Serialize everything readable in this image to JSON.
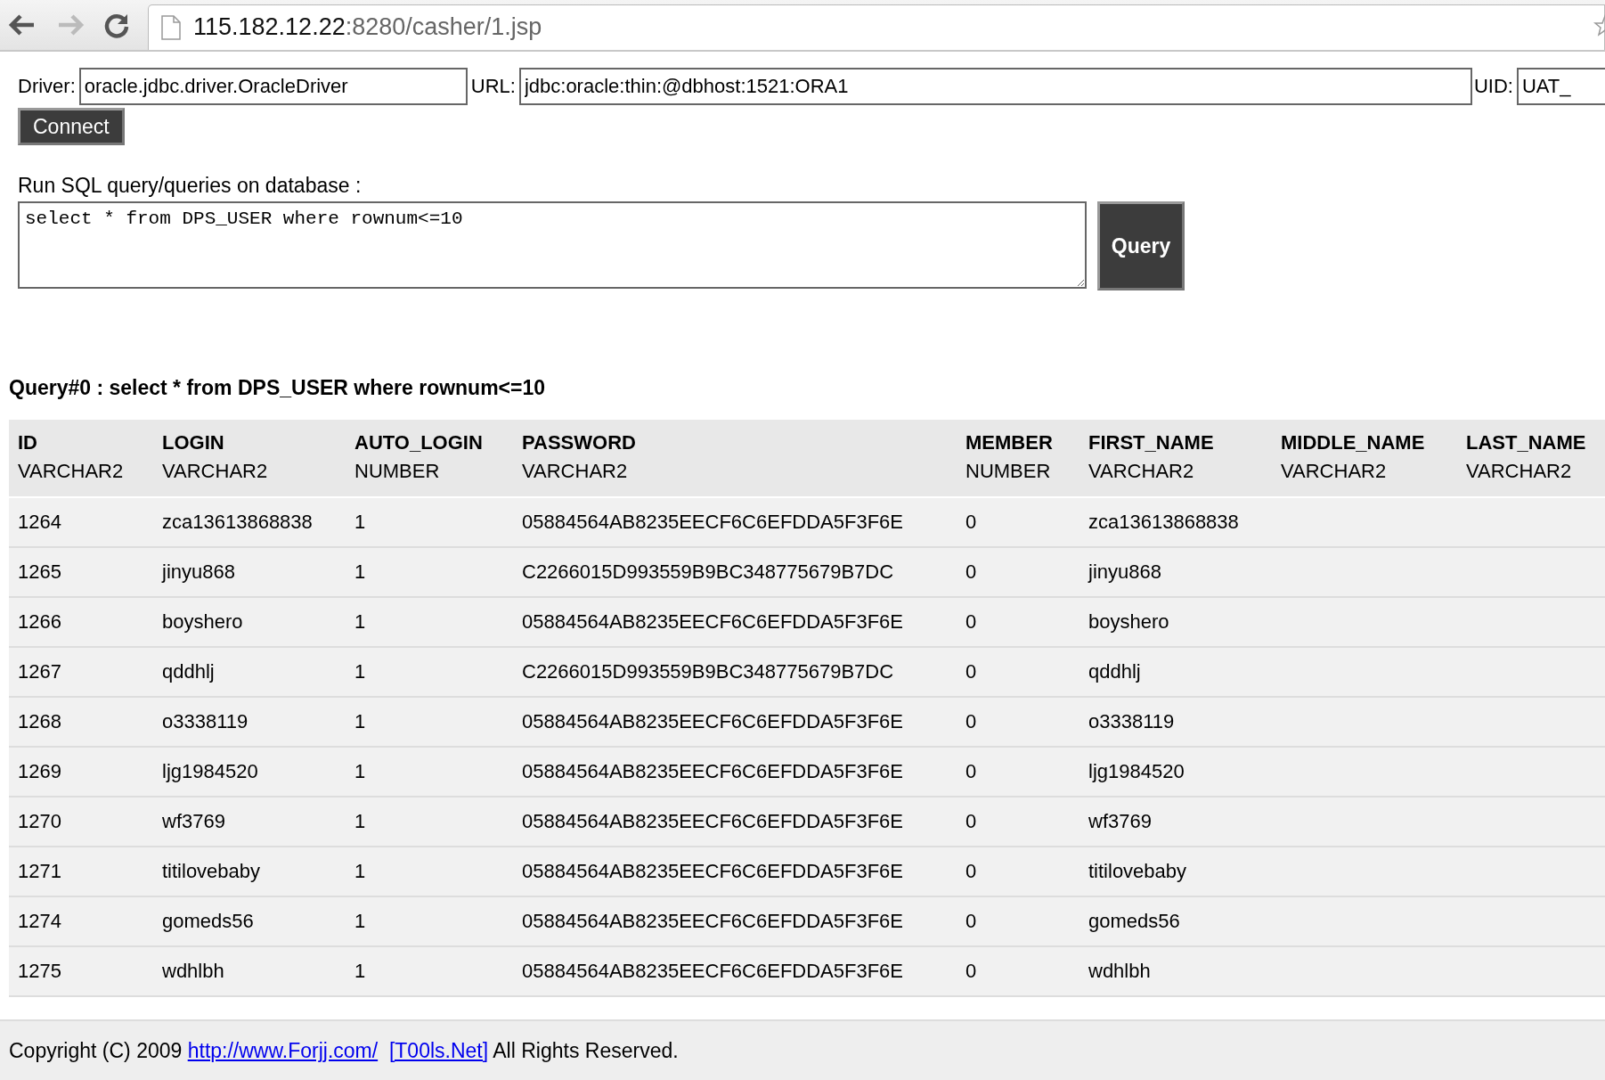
{
  "browser": {
    "address_host": "115.182.12.22",
    "address_path": ":8280/casher/1.jsp",
    "forward_disabled": true
  },
  "connection": {
    "driver_label": "Driver:",
    "driver_value": "oracle.jdbc.driver.OracleDriver",
    "url_label": "URL:",
    "url_value": "jdbc:oracle:thin:@dbhost:1521:ORA1",
    "uid_label": "UID:",
    "uid_value": "UAT_",
    "connect_button": "Connect"
  },
  "query_form": {
    "label": "Run SQL query/queries on database :",
    "sql": "select * from DPS_USER where rownum<=10",
    "query_button": "Query"
  },
  "result": {
    "heading": "Query#0 : select * from DPS_USER where rownum<=10",
    "columns": [
      {
        "name": "ID",
        "type": "VARCHAR2"
      },
      {
        "name": "LOGIN",
        "type": "VARCHAR2"
      },
      {
        "name": "AUTO_LOGIN",
        "type": "NUMBER"
      },
      {
        "name": "PASSWORD",
        "type": "VARCHAR2"
      },
      {
        "name": "MEMBER",
        "type": "NUMBER"
      },
      {
        "name": "FIRST_NAME",
        "type": "VARCHAR2"
      },
      {
        "name": "MIDDLE_NAME",
        "type": "VARCHAR2"
      },
      {
        "name": "LAST_NAME",
        "type": "VARCHAR2"
      }
    ],
    "rows": [
      [
        "1264",
        "zca13613868838",
        "1",
        "05884564AB8235EECF6C6EFDDA5F3F6E",
        "0",
        "zca13613868838"
      ],
      [
        "1265",
        "jinyu868",
        "1",
        "C2266015D993559B9BC348775679B7DC",
        "0",
        "jinyu868"
      ],
      [
        "1266",
        "boyshero",
        "1",
        "05884564AB8235EECF6C6EFDDA5F3F6E",
        "0",
        "boyshero"
      ],
      [
        "1267",
        "qddhlj",
        "1",
        "C2266015D993559B9BC348775679B7DC",
        "0",
        "qddhlj"
      ],
      [
        "1268",
        "o3338119",
        "1",
        "05884564AB8235EECF6C6EFDDA5F3F6E",
        "0",
        "o3338119"
      ],
      [
        "1269",
        "ljg1984520",
        "1",
        "05884564AB8235EECF6C6EFDDA5F3F6E",
        "0",
        "ljg1984520"
      ],
      [
        "1270",
        "wf3769",
        "1",
        "05884564AB8235EECF6C6EFDDA5F3F6E",
        "0",
        "wf3769"
      ],
      [
        "1271",
        "titilovebaby",
        "1",
        "05884564AB8235EECF6C6EFDDA5F3F6E",
        "0",
        "titilovebaby"
      ],
      [
        "1274",
        "gomeds56",
        "1",
        "05884564AB8235EECF6C6EFDDA5F3F6E",
        "0",
        "gomeds56"
      ],
      [
        "1275",
        "wdhlbh",
        "1",
        "05884564AB8235EECF6C6EFDDA5F3F6E",
        "0",
        "wdhlbh"
      ]
    ]
  },
  "footer": {
    "text_before": "Copyright (C) 2009",
    "link_1": "http://www.Forjj.com/",
    "link_2": "[T00ls.Net]",
    "text_after": "All Rights Reserved."
  }
}
